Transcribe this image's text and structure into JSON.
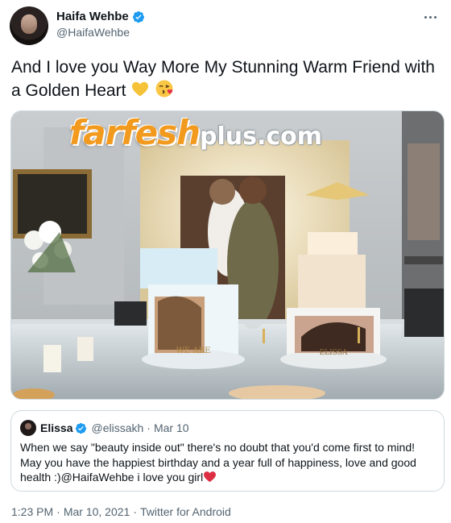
{
  "author": {
    "display_name": "Haifa Wehbe",
    "handle": "@HaifaWehbe",
    "verified": true,
    "avatar_icon": "profile-photo"
  },
  "tweet": {
    "text": "And I love you Way More My Stunning Warm Friend with a Golden Heart",
    "emojis": [
      "yellow-heart",
      "face-blowing-a-kiss"
    ]
  },
  "media": {
    "watermark_main": "farfesh",
    "watermark_suffix": "plus.com",
    "cake_label_left": "WE ARE",
    "cake_label_right": "ELISSA"
  },
  "quoted_tweet": {
    "display_name": "Elissa",
    "handle": "@elissakh",
    "separator": "·",
    "date": "Mar 10",
    "verified": true,
    "text": "When we say \"beauty inside out\" there's no doubt that you'd come first to mind! May you have the happiest birthday and a year full of happiness, love and good health :)@HaifaWehbe i love you girl",
    "trailing_emoji": "red-heart"
  },
  "meta": {
    "time": "1:23 PM",
    "separator": "·",
    "date": "Mar 10, 2021",
    "source": "Twitter for Android"
  },
  "colors": {
    "verified_blue": "#1d9bf0",
    "secondary_text": "#536471",
    "border": "#cfd9de",
    "watermark_orange": "#f29a1e"
  }
}
